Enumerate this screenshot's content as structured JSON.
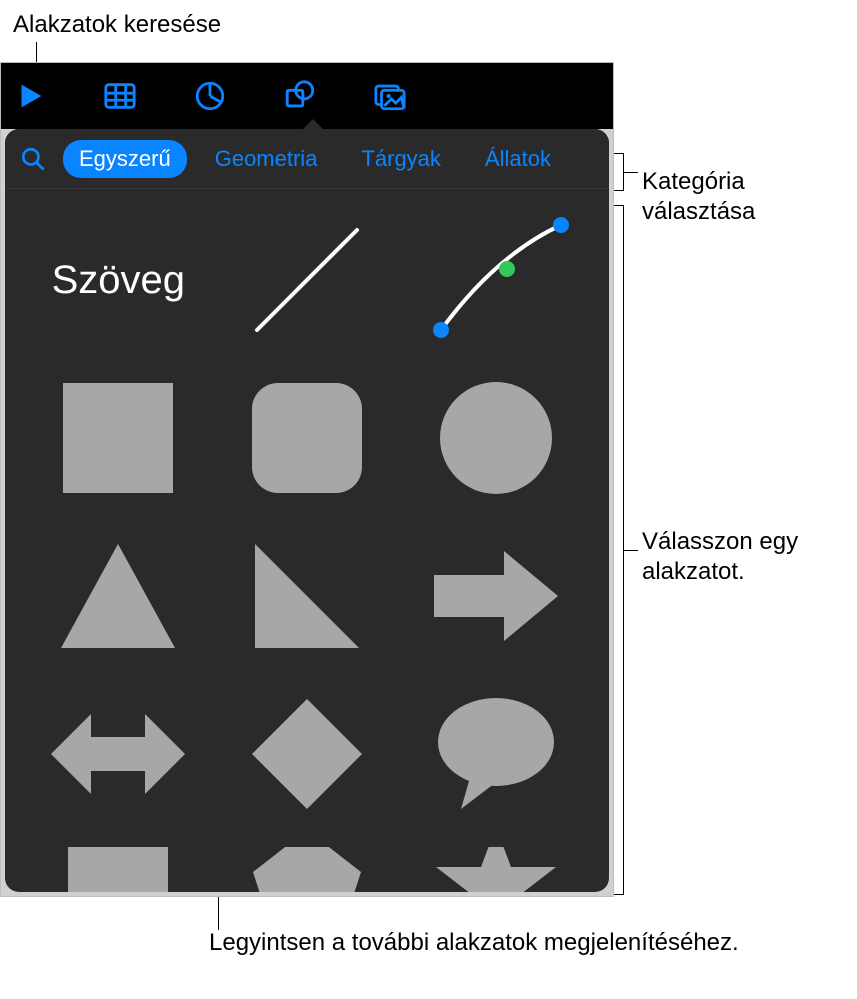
{
  "callouts": {
    "search": "Alakzatok keresése",
    "category": "Kategória választása",
    "choose_shape": "Válasszon egy alakzatot.",
    "swipe_more": "Legyintsen a további alakzatok megjelenítéséhez."
  },
  "toolbar": {
    "items": [
      "play-icon",
      "table-icon",
      "chart-icon",
      "shapes-icon",
      "media-icon"
    ]
  },
  "popover": {
    "search_label": "Keresés",
    "tabs": [
      {
        "label": "Egyszerű",
        "active": true
      },
      {
        "label": "Geometria",
        "active": false
      },
      {
        "label": "Tárgyak",
        "active": false
      },
      {
        "label": "Állatok",
        "active": false
      }
    ],
    "text_shape_label": "Szöveg",
    "shapes": [
      "text",
      "line",
      "curve",
      "square",
      "rounded-square",
      "circle",
      "triangle",
      "right-triangle",
      "arrow-right",
      "arrow-left-right",
      "diamond",
      "speech-bubble",
      "tab-shape",
      "pentagon",
      "star"
    ]
  }
}
